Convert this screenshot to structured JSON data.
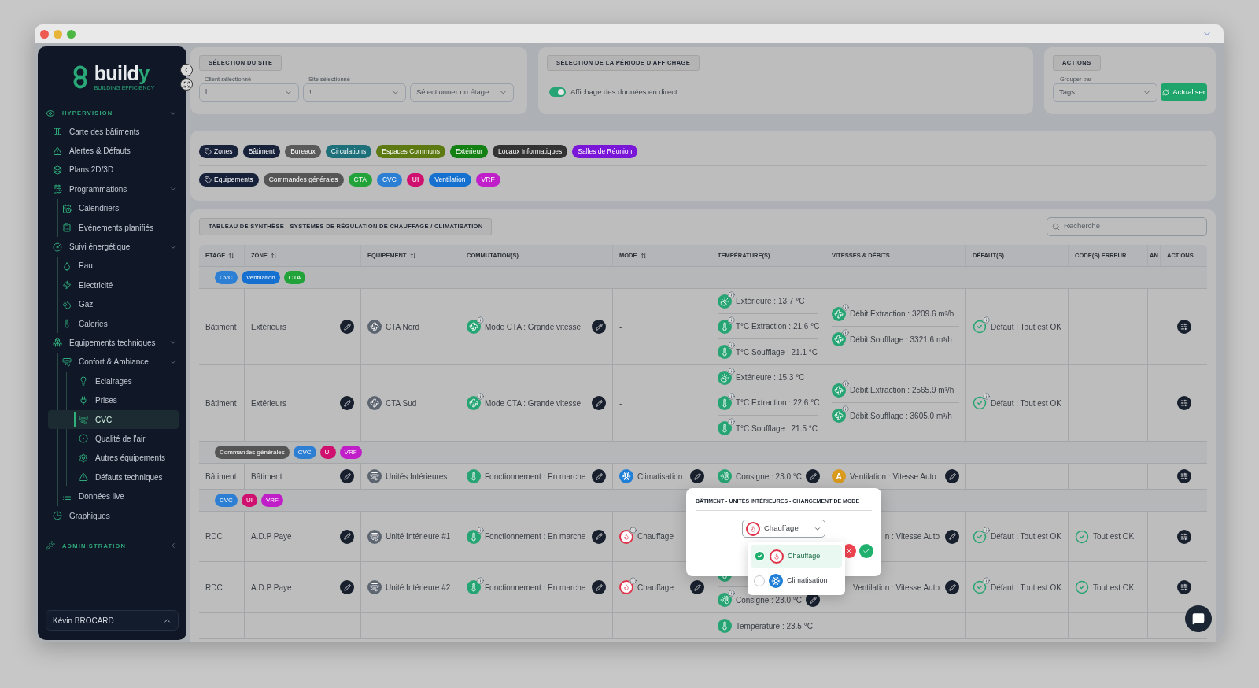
{
  "sidebar": {
    "logo": {
      "text": "build",
      "accent": "y",
      "tagline": "BUILDING EFFICIENCY"
    },
    "sections": [
      {
        "label": "HYPERVISION",
        "expanded": true,
        "items": [
          {
            "label": "Carte des bâtiments",
            "selected": false
          },
          {
            "label": "Alertes & Défauts",
            "selected": false
          },
          {
            "label": "Plans 2D/3D",
            "selected": false
          },
          {
            "label": "Programmations",
            "selected": false,
            "expanded": true,
            "children": [
              {
                "label": "Calendriers",
                "selected": false
              },
              {
                "label": "Evénements planifiés",
                "selected": false
              }
            ]
          },
          {
            "label": "Suivi énergétique",
            "selected": false,
            "expanded": true,
            "children": [
              {
                "label": "Eau",
                "selected": false
              },
              {
                "label": "Electricité",
                "selected": false
              },
              {
                "label": "Gaz",
                "selected": false
              },
              {
                "label": "Calories",
                "selected": false
              }
            ]
          },
          {
            "label": "Equipements techniques",
            "selected": false,
            "expanded": true,
            "children": [
              {
                "label": "Confort & Ambiance",
                "selected": false,
                "expanded": true,
                "children": [
                  {
                    "label": "Eclairages",
                    "selected": false
                  },
                  {
                    "label": "Prises",
                    "selected": false
                  },
                  {
                    "label": "CVC",
                    "selected": true
                  },
                  {
                    "label": "Qualité de l'air",
                    "selected": false
                  },
                  {
                    "label": "Autres équipements",
                    "selected": false
                  },
                  {
                    "label": "Défauts techniques",
                    "selected": false
                  }
                ]
              },
              {
                "label": "Données live",
                "selected": false
              }
            ]
          },
          {
            "label": "Graphiques",
            "selected": false
          }
        ]
      },
      {
        "label": "ADMINISTRATION",
        "expanded": false
      }
    ],
    "user": "Kévin BROCARD"
  },
  "site_selection": {
    "title": "SÉLECTION DU SITE",
    "fields": [
      {
        "label": "Client sélectionné",
        "value": "l"
      },
      {
        "label": "Site sélectionné",
        "value": "!"
      },
      {
        "placeholder": "Sélectionner un étage"
      }
    ]
  },
  "period": {
    "title": "SÉLECTION DE LA PÉRIODE D'AFFICHAGE",
    "toggle": {
      "label": "Affichage des données en direct",
      "on": true
    }
  },
  "actions": {
    "title": "ACTIONS",
    "group_by": {
      "label": "Grouper par",
      "value": "Tags"
    },
    "refresh": "Actualiser"
  },
  "tag_filters": [
    {
      "tags": [
        {
          "label": "Zones",
          "kind": "heading",
          "color": "#17213a"
        },
        {
          "label": "Bâtiment",
          "color": "#17213a"
        },
        {
          "label": "Bureaux",
          "color": "#5a5a5a"
        },
        {
          "label": "Circulations",
          "color": "#1d6f7a"
        },
        {
          "label": "Espaces Communs",
          "color": "#5d7a12"
        },
        {
          "label": "Extérieur",
          "color": "#128012"
        },
        {
          "label": "Locaux Informatiques",
          "color": "#333333"
        },
        {
          "label": "Salles de Réunion",
          "color": "#7a16d8"
        }
      ]
    },
    {
      "tags": [
        {
          "label": "Équipements",
          "kind": "heading",
          "color": "#17213a"
        },
        {
          "label": "Commandes générales",
          "color": "#555555"
        },
        {
          "label": "CTA",
          "color": "#22a33a"
        },
        {
          "label": "CVC",
          "color": "#2d7fd4"
        },
        {
          "label": "UI",
          "color": "#d0106e"
        },
        {
          "label": "Ventilation",
          "color": "#1570d0"
        },
        {
          "label": "VRF",
          "color": "#c01ec8"
        }
      ]
    }
  ],
  "table": {
    "title": "TABLEAU DE SYNTHÈSE - SYSTÈMES DE RÉGULATION DE CHAUFFAGE / CLIMATISATION",
    "search": {
      "placeholder": "Recherche"
    },
    "columns": [
      {
        "label": "ETAGE",
        "sortable": true
      },
      {
        "label": "ZONE",
        "sortable": true
      },
      {
        "label": "EQUIPEMENT",
        "sortable": true
      },
      {
        "label": "COMMUTATION(S)",
        "sortable": false
      },
      {
        "label": "MODE",
        "sortable": true
      },
      {
        "label": "TEMPÉRATURE(S)",
        "sortable": false
      },
      {
        "label": "VITESSES & DÉBITS",
        "sortable": false
      },
      {
        "label": "DÉFAUT(S)",
        "sortable": false
      },
      {
        "label": "CODE(S) ERREUR",
        "sortable": false
      },
      {
        "label": "AN",
        "sortable": false
      },
      {
        "label": "ACTIONS",
        "sortable": false
      }
    ],
    "groups": [
      {
        "tags": [
          {
            "label": "CVC",
            "color": "#2d7fd4"
          },
          {
            "label": "Ventilation",
            "color": "#1570d0"
          },
          {
            "label": "CTA",
            "color": "#22a33a"
          }
        ],
        "rows": [
          {
            "etage": "Bâtiment",
            "zone": {
              "text": "Extérieurs",
              "editable": true
            },
            "equipment": {
              "kind": "cta",
              "text": "CTA Nord"
            },
            "commutation": {
              "kind": "cta-mode",
              "text": "Mode CTA : Grande vitesse",
              "info": true,
              "editable": true
            },
            "mode": {
              "text": "-"
            },
            "temperatures": [
              {
                "kind": "outdoor",
                "text": "Extérieure : 13.7 °C",
                "info": true
              },
              {
                "kind": "temperature",
                "text": "T°C Extraction : 21.6 °C",
                "info": true
              },
              {
                "kind": "temperature",
                "text": "T°C Soufflage : 21.1 °C",
                "info": true
              }
            ],
            "speeds": [
              {
                "kind": "flow",
                "text": "Débit Extraction : 3209.6 m³/h",
                "info": true
              },
              {
                "kind": "flow",
                "text": "Débit Soufflage : 3321.6 m³/h",
                "info": true
              }
            ],
            "fault": {
              "text": "Défaut : Tout est OK",
              "info": true
            },
            "actions": true
          },
          {
            "etage": "Bâtiment",
            "zone": {
              "text": "Extérieurs",
              "editable": true
            },
            "equipment": {
              "kind": "cta",
              "text": "CTA Sud"
            },
            "commutation": {
              "kind": "cta-mode",
              "text": "Mode CTA : Grande vitesse",
              "info": true,
              "editable": true
            },
            "mode": {
              "text": "-"
            },
            "temperatures": [
              {
                "kind": "outdoor",
                "text": "Extérieure : 15.3 °C",
                "info": true
              },
              {
                "kind": "temperature",
                "text": "T°C Extraction : 22.6 °C",
                "info": true
              },
              {
                "kind": "temperature",
                "text": "T°C Soufflage : 21.5 °C",
                "info": true
              }
            ],
            "speeds": [
              {
                "kind": "flow",
                "text": "Débit Extraction : 2565.9 m³/h",
                "info": true
              },
              {
                "kind": "flow",
                "text": "Débit Soufflage : 3605.0 m³/h",
                "info": true
              }
            ],
            "fault": {
              "text": "Défaut : Tout est OK",
              "info": true
            },
            "actions": true
          }
        ]
      },
      {
        "tags": [
          {
            "label": "Commandes générales",
            "color": "#555555"
          },
          {
            "label": "CVC",
            "color": "#2d7fd4"
          },
          {
            "label": "UI",
            "color": "#d0106e"
          },
          {
            "label": "VRF",
            "color": "#c01ec8"
          }
        ],
        "rows": [
          {
            "etage": "Bâtiment",
            "zone": {
              "text": "Bâtiment",
              "editable": true
            },
            "equipment": {
              "kind": "indoor-unit",
              "text": "Unités Intérieures"
            },
            "commutation": {
              "kind": "operation",
              "text": "Fonctionnement : En marche",
              "info": false,
              "editable": true
            },
            "mode": {
              "kind": "cooling",
              "text": "Climatisation",
              "info": false,
              "editable": true
            },
            "temperatures": [
              {
                "kind": "setpoint",
                "text": "Consigne : 23.0 °C",
                "info": false,
                "editable": true
              }
            ],
            "speeds": [
              {
                "kind": "auto",
                "badge": "A",
                "text": "Ventilation : Vitesse Auto",
                "info": false,
                "editable": true
              }
            ],
            "actions": true
          }
        ]
      },
      {
        "tags": [
          {
            "label": "CVC",
            "color": "#2d7fd4"
          },
          {
            "label": "UI",
            "color": "#d0106e"
          },
          {
            "label": "VRF",
            "color": "#c01ec8"
          }
        ],
        "rows": [
          {
            "etage": "RDC",
            "zone": {
              "text": "A.D.P Paye",
              "editable": true
            },
            "equipment": {
              "kind": "indoor-unit",
              "text": "Unité Intérieure #1"
            },
            "commutation": {
              "kind": "operation",
              "text": "Fonctionnement : En marche",
              "info": true,
              "editable": true
            },
            "mode": {
              "kind": "heating",
              "text": "Chauffage",
              "info": true,
              "editable": false
            },
            "speeds": [
              {
                "kind": "partial",
                "text": "n : Vitesse Auto",
                "editable": true
              }
            ],
            "fault": {
              "text": "Défaut : Tout est OK",
              "info": true
            },
            "error_code": {
              "text": "Tout est OK"
            },
            "actions": true
          },
          {
            "etage": "RDC",
            "zone": {
              "text": "A.D.P Paye",
              "editable": true
            },
            "equipment": {
              "kind": "indoor-unit",
              "text": "Unité Intérieure #2"
            },
            "commutation": {
              "kind": "operation",
              "text": "Fonctionnement : En marche",
              "info": true,
              "editable": true
            },
            "mode": {
              "kind": "heating",
              "text": "Chauffage",
              "info": true,
              "editable": true
            },
            "temperatures": [
              {
                "kind": "temperature"
              },
              {
                "kind": "setpoint",
                "text": "Consigne : 23.0 °C",
                "info": true,
                "editable": true
              }
            ],
            "speeds": [
              {
                "kind": "partial",
                "text": "Ventilation : Vitesse Auto",
                "editable": true
              }
            ],
            "fault": {
              "text": "Défaut : Tout est OK",
              "info": true
            },
            "error_code": {
              "text": "Tout est OK"
            },
            "actions": true
          },
          {
            "temperatures": [
              {
                "kind": "temperature",
                "text": "Température : 23.5 °C",
                "info": false
              }
            ]
          }
        ]
      }
    ]
  },
  "mode_dialog": {
    "title": "BÂTIMENT - UNITÉS INTÉRIEURES - CHANGEMENT DE MODE",
    "value": {
      "kind": "heating",
      "text": "Chauffage"
    },
    "options": [
      {
        "kind": "heating",
        "label": "Chauffage",
        "selected": true
      },
      {
        "kind": "cooling",
        "label": "Climatisation",
        "selected": false
      }
    ]
  }
}
